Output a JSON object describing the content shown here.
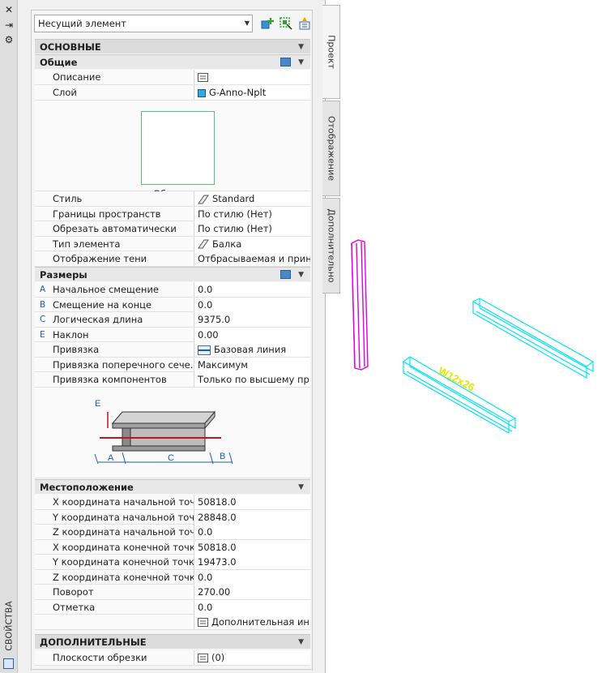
{
  "title_bar": {
    "close": "✕",
    "autohide": "⇥",
    "settings": "⚙",
    "vertical_title": "СВОЙСТВА"
  },
  "object_selector": {
    "value": "Несущий элемент"
  },
  "side_tabs": [
    "Проект",
    "Отображение",
    "Дополнительно"
  ],
  "categories": {
    "basic": "ОСНОВНЫЕ",
    "general": "Общие",
    "dimensions": "Размеры",
    "location": "Местоположение",
    "extra": "ДОПОЛНИТЕЛЬНЫЕ"
  },
  "general_rows": [
    {
      "label": "Описание",
      "value": ""
    },
    {
      "label": "Слой",
      "value": "G-Anno-Nplt"
    }
  ],
  "preview_caption": "Обзор...",
  "general_rows2": [
    {
      "label": "Стиль",
      "value": "Standard"
    },
    {
      "label": "Границы пространств",
      "value": "По стилю (Нет)"
    },
    {
      "label": "Обрезать автоматически",
      "value": "По стилю (Нет)"
    },
    {
      "label": "Тип элемента",
      "value": "Балка"
    },
    {
      "label": "Отображение тени",
      "value": "Отбрасываемая и прин..."
    }
  ],
  "dimension_rows": [
    {
      "key": "A",
      "label": "Начальное смещение",
      "value": "0.0"
    },
    {
      "key": "B",
      "label": "Смещение на конце",
      "value": "0.0"
    },
    {
      "key": "C",
      "label": "Логическая длина",
      "value": "9375.0"
    },
    {
      "key": "E",
      "label": "Наклон",
      "value": "0.00"
    },
    {
      "key": "",
      "label": "Привязка",
      "value": "Базовая линия"
    },
    {
      "key": "",
      "label": "Привязка поперечного сече...",
      "value": "Максимум"
    },
    {
      "key": "",
      "label": "Привязка компонентов",
      "value": "Только по высшему пр..."
    }
  ],
  "diagram_labels": {
    "e": "E",
    "a": "A",
    "c": "C",
    "b": "B"
  },
  "location_rows": [
    {
      "label": "X координата начальной точ...",
      "value": "50818.0"
    },
    {
      "label": "Y координата начальной точ...",
      "value": "28848.0"
    },
    {
      "label": "Z координата начальной точ...",
      "value": "0.0"
    },
    {
      "label": "X координата конечной точки",
      "value": "50818.0"
    },
    {
      "label": "Y координата конечной точки",
      "value": "19473.0"
    },
    {
      "label": "Z координата конечной точки",
      "value": "0.0"
    },
    {
      "label": "Поворот",
      "value": "270.00"
    },
    {
      "label": "Отметка",
      "value": "0.0"
    },
    {
      "label": "",
      "value": "Дополнительная ин..."
    }
  ],
  "extra_rows": [
    {
      "label": "Плоскости обрезки",
      "value": "(0)"
    }
  ],
  "canvas": {
    "beam_tag": "W12x26"
  },
  "colors": {
    "magenta_beam": "#e000e0",
    "cyan_beam": "#00e5f0",
    "tag": "#e6e600"
  }
}
